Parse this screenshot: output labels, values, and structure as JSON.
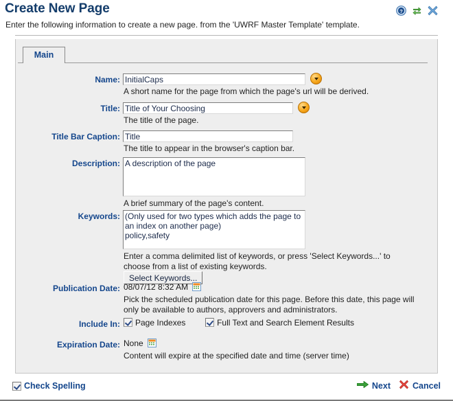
{
  "header": {
    "title": "Create New Page",
    "subtitle": "Enter the following information to create a new page. from the 'UWRF Master Template' template.",
    "icons": [
      {
        "name": "help-icon",
        "glyph": "?"
      },
      {
        "name": "refresh-icon",
        "glyph": "⇄"
      },
      {
        "name": "close-icon",
        "glyph": "✕"
      }
    ]
  },
  "tabs": [
    {
      "label": "Main",
      "active": true
    }
  ],
  "form": {
    "name": {
      "label": "Name:",
      "value": "InitialCaps",
      "help": "A short name for the page from which the page's url will be derived.",
      "picker": "▼"
    },
    "title": {
      "label": "Title:",
      "value": "Title of Your Choosing",
      "help": "The title of the page.",
      "picker": "▼"
    },
    "title_bar_caption": {
      "label": "Title Bar Caption:",
      "value": "Title",
      "help": "The title to appear in the browser's caption bar."
    },
    "description": {
      "label": "Description:",
      "value": "A description of the page",
      "help": "A brief summary of the page's content."
    },
    "keywords": {
      "label": "Keywords:",
      "value": "(Only used for two types which adds the page to an index on another page)\npolicy,safety",
      "help": "Enter a comma delimited list of keywords, or press 'Select Keywords...' to choose from a list of existing keywords.",
      "button": "Select Keywords..."
    },
    "publication_date": {
      "label": "Publication Date:",
      "value": "08/07/12 8:32 AM",
      "help": "Pick the scheduled publication date for this page. Before this date, this page will only be available to authors, approvers and administrators.",
      "calendar_icon": "calendar-icon"
    },
    "include_in": {
      "label": "Include In:",
      "options": [
        {
          "label": "Page Indexes",
          "checked": true
        },
        {
          "label": "Full Text and Search Element Results",
          "checked": true
        }
      ]
    },
    "expiration_date": {
      "label": "Expiration Date:",
      "value": "None",
      "help": "Content will expire at the specified date and time (server time)",
      "calendar_icon": "calendar-icon"
    }
  },
  "footer": {
    "check_spelling": {
      "label": "Check Spelling",
      "checked": true
    },
    "next": {
      "label": "Next",
      "icon": "arrow-right-icon"
    },
    "cancel": {
      "label": "Cancel",
      "icon": "x-icon"
    }
  },
  "colors": {
    "title_blue": "#143d6b",
    "label_blue": "#14468c",
    "panel_gray": "#eeeeee",
    "accent_orange": "#f7a81c",
    "next_green": "#2e9e2e",
    "cancel_red": "#e03030"
  }
}
